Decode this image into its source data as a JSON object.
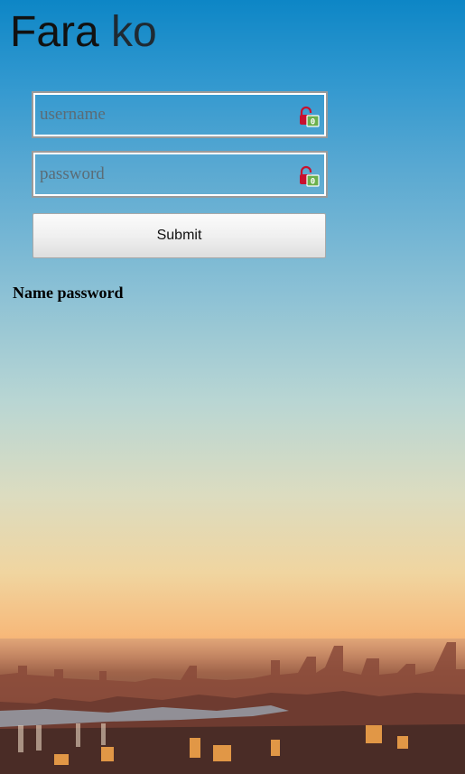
{
  "header": {
    "title_part1": "Fara",
    "title_part2": "ko"
  },
  "form": {
    "username": {
      "placeholder": "username",
      "value": ""
    },
    "password": {
      "placeholder": "password",
      "value": ""
    },
    "submit_label": "Submit"
  },
  "result_text": "Name password",
  "icons": {
    "field_icon": "password-manager-lock-icon",
    "lock_color": "#c8102e",
    "badge_color": "#6ab04c"
  }
}
